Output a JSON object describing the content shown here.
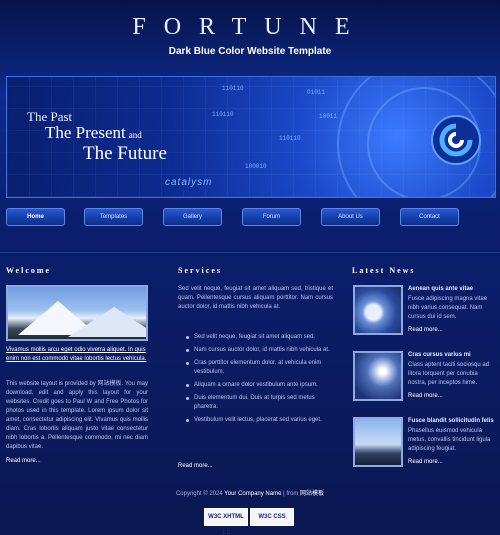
{
  "header": {
    "brand": "FORTUNE",
    "tagline": "Dark Blue Color Website Template"
  },
  "hero": {
    "line1": "The Past",
    "line2": "The Present",
    "line2_small": "and",
    "line3": "The Future",
    "binary": [
      "110110",
      "01011",
      "110110",
      "100010",
      "110110",
      "10011"
    ],
    "catalyst_text": "catalysm"
  },
  "nav": {
    "items": [
      "Home",
      "Templates",
      "Gallery",
      "Forum",
      "About Us",
      "Contact"
    ],
    "active_index": 0
  },
  "welcome": {
    "heading": "Welcome",
    "link_text": "Vivamus mollis arcu eget odio viverra aliquet. In quis enim non est commodo vitae lobortis lectus vehicula.",
    "body": "This website layout is provided by 网站模板. You may download, edit and apply this layout for your websites. Credit goes to Paul W and Free Photos for photos used in this template. Lorem ipsum dolor sit amet, consectetur adipiscing elit. Vivamus quis mollis diam. Cras lobortis aliquam justo vitae consectetur nibh lobortis a. Pellentesque commodo, mi nec diam dapibus vitae.",
    "read_more": "Read more..."
  },
  "services": {
    "heading": "Services",
    "intro": "Sed velit neque, feugiat sit amet aliquam sed, tristique et quam. Pellentesque cursus aliquam porttitor. Nam cursus auctor dolor, id mattis nibh vehicula at.",
    "items": [
      "Sed velit neque, feugiat sit amet aliquam sed.",
      "Nam cursus auctor dolor, id mattis nibh vehicula at.",
      "Cras porttitor elementum dolor, at vehicula enim vestibulum.",
      "Aliquam a ornare dolor vestibulum ante ipsum.",
      "Duis elementum dui. Duis at turpis sed metus pharetra.",
      "Vestibulum velit lectus, placerat sed varius eget."
    ],
    "read_more": "Read more..."
  },
  "news": {
    "heading": "Latest News",
    "items": [
      {
        "title": "Aenean quis ante vitae",
        "body": "Fusce adipiscing magna vitae nibh varius consequat. Nam cursus dui id sem.",
        "read_more": "Read more..."
      },
      {
        "title": "Cras cursus varius mi",
        "body": "Class aptent taciti sociosqu ad litora torquent per conubia nostra, per inceptos hime.",
        "read_more": "Read more..."
      },
      {
        "title": "Fusce blandit sollicitudin felis",
        "body": "Phasellus euismod vehicula metus, convallis tincidunt ligula adipiscing feugiat.",
        "read_more": "Read more..."
      }
    ]
  },
  "footer": {
    "copyright": "Copyright © 2024",
    "company": "Your Company Name",
    "separator": "| from",
    "credit": "网站模板"
  },
  "badges": {
    "xhtml": "W3C XHTML 1.0",
    "css": "W3C CSS"
  },
  "colors": {
    "background": "#0b1a5a",
    "accent": "#3e6fe0"
  }
}
